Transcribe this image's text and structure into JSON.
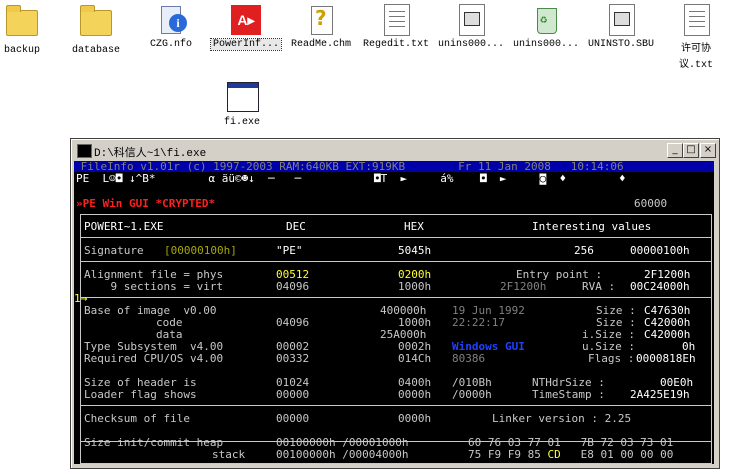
{
  "desktop": {
    "icons": [
      {
        "label": "backup",
        "kind": "folder"
      },
      {
        "label": "database",
        "kind": "folder"
      },
      {
        "label": "CZG.nfo",
        "kind": "info"
      },
      {
        "label": "PowerInf...",
        "kind": "app"
      },
      {
        "label": "ReadMe.chm",
        "kind": "help"
      },
      {
        "label": "Regedit.txt",
        "kind": "doc"
      },
      {
        "label": "unins000...",
        "kind": "dat"
      },
      {
        "label": "unins000...",
        "kind": "recycle"
      },
      {
        "label": "UNINSTO.SBU",
        "kind": "dat"
      },
      {
        "label": "许可协议.txt",
        "kind": "doc"
      },
      {
        "label": "fi.exe",
        "kind": "exe"
      }
    ]
  },
  "window": {
    "title": "D:\\科信人~1\\fi.exe",
    "minimize": "_",
    "maximize": "□",
    "close": "×"
  },
  "console": {
    "header": " FileInfo v1.01r (c) 1997-2003 RAM:640KB EXT:919KB        Fr 11 Jan 2008   10:14:06",
    "symbols": "PE  L☺◘ ↓^B*        α äü©☻↓  ─   ─           ◘T  ►     á%    ◘  ►     ◙  ♦        ♦",
    "type_line": "»PE Win GUI *CRYPTED*",
    "type_value": "60000",
    "col_file": "POWERI~1.EXE",
    "col_dec": "DEC",
    "col_hex": "HEX",
    "col_interesting": "Interesting values",
    "sig_label": "Signature ",
    "sig_bracket": "[00000100h]",
    "sig_dec": "\"PE\"",
    "sig_hex": "5045h",
    "sig_v1": "256",
    "sig_v2": "00000100h",
    "align_label": "Alignment file = phys",
    "align_dec": "00512",
    "align_hex": "0200h",
    "entry_label": "Entry point :",
    "entry_val": "2F1200h",
    "sections_label": "    9 sections = virt",
    "sections_dec": "04096",
    "sections_hex": "1000h",
    "rva_prev": "2F1200h",
    "rva_label": "RVA :",
    "rva_val": "00C24000h",
    "marker": "1→",
    "base_label": "Base of image  v0.00",
    "base_hex": "400000h",
    "base_date": "19 Jun 1992",
    "base_size_l": "Size :",
    "base_size_v": "C47630h",
    "code_label": "code",
    "code_dec": "04096",
    "code_hex": "1000h",
    "code_time": "22:22:17",
    "code_size_l": "Size :",
    "code_size_v": "C42000h",
    "data_label": "data",
    "data_hex": "25A000h",
    "data_size_l": "i.Size :",
    "data_size_v": "C42000h",
    "sub_label": "Type Subsystem  v4.00",
    "sub_dec": "00002",
    "sub_hex": "0002h",
    "sub_type": "Windows GUI",
    "usize_l": "u.Size :",
    "usize_v": "0h",
    "cpu_label": "Required CPU/OS v4.00",
    "cpu_dec": "00332",
    "cpu_hex": "014Ch",
    "cpu_type": "80386",
    "flags_l": "Flags :",
    "flags_v": "0000818Eh",
    "hdr_label": "Size of header is",
    "hdr_dec": "01024",
    "hdr_hex": "0400h",
    "hdr_x": "/010Bh",
    "nth_l": "NTHdrSize :",
    "nth_v": "00E0h",
    "ldr_label": "Loader flag shows",
    "ldr_dec": "00000",
    "ldr_hex": "0000h",
    "ldr_x": "/0000h",
    "ts_l": "TimeStamp :",
    "ts_v": "2A425E19h",
    "chk_label": "Checksum of file",
    "chk_dec": "00000",
    "chk_hex": "0000h",
    "linker": "Linker version : 2.25",
    "heap_label": "Size init/commit heap",
    "heap_val": "00100000h /00001000h",
    "stack_label": "stack",
    "stack_val": "00100000h /00004000h",
    "bytes1": "60 76 03 77 01   7B 72 03 73 01",
    "bytes2a": "75 F9 F9 85 ",
    "bytes2b": "CD",
    "bytes2c": "   E8 01 00 00 00"
  }
}
